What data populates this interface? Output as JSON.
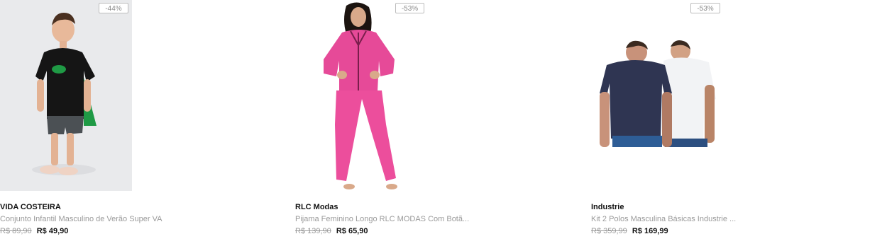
{
  "products": [
    {
      "discount": "-44%",
      "brand": "VIDA COSTEIRA",
      "title": "Conjunto Infantil Masculino de Verão Super VA",
      "old_price": "R$ 89,90",
      "price": "R$ 49,90"
    },
    {
      "discount": "-53%",
      "brand": "RLC Modas",
      "title": "Pijama Feminino Longo RLC MODAS Com Botã...",
      "old_price": "R$ 139,90",
      "price": "R$ 65,90"
    },
    {
      "discount": "-53%",
      "brand": "Industrie",
      "title": "Kit 2 Polos Masculina Básicas Industrie ...",
      "old_price": "R$ 359,99",
      "price": "R$ 169,99"
    }
  ]
}
